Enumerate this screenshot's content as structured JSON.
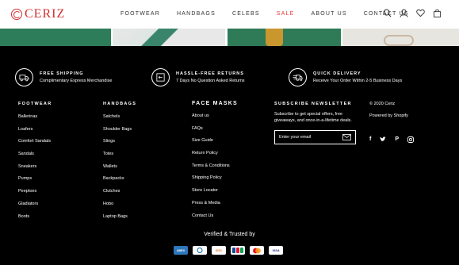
{
  "brand": {
    "name": "CERIZ",
    "color": "#d32f2f"
  },
  "nav": {
    "items": [
      "FOOTWEAR",
      "HANDBAGS",
      "CELEBS",
      "SALE",
      "ABOUT US",
      "CONTACT US"
    ],
    "sale_color": "#e53935"
  },
  "header_icons": [
    "search-icon",
    "account-icon",
    "wishlist-icon",
    "cart-icon"
  ],
  "promos": [
    {
      "title": "FREE SHIPPING",
      "subtitle": "Complimentary Express Merchandise",
      "icon": "truck-icon"
    },
    {
      "title": "HASSLE-FREE RETURNS",
      "subtitle": "7 Days No Question Asked Returns",
      "icon": "return-box-icon"
    },
    {
      "title": "QUICK DELIVERY",
      "subtitle": "Receive Your Order Within 2-5 Business Days",
      "icon": "delivery-icon"
    }
  ],
  "columns": {
    "footwear": {
      "heading": "FOOTWEAR",
      "links": [
        "Ballerinas",
        "Loafers",
        "Comfort Sandals",
        "Sandals",
        "Sneakers",
        "Pumps",
        "Peeptoes",
        "Gladiators",
        "Boots"
      ]
    },
    "handbags": {
      "heading": "HANDBAGS",
      "links": [
        "Satchels",
        "Shoulder Bags",
        "Slings",
        "Totes",
        "Wallets",
        "Backpacks",
        "Clutches",
        "Hobo",
        "Laptop Bags"
      ]
    },
    "facemasks": {
      "heading": "FACE MASKS",
      "links": [
        "About us",
        "FAQs",
        "Size Guide",
        "Return Policy",
        "Terms & Conditions",
        "Shipping Policy",
        "Store Locator",
        "Press & Media",
        "Contact Us"
      ]
    },
    "newsletter": {
      "heading": "SUBSCRIBE NEWSLETTER",
      "text": "Subscribe to get special offers, free giveaways, and once-in-a-lifetime deals.",
      "placeholder": "Enter your email"
    },
    "info": {
      "copyright": "© 2020 Ceriz",
      "powered": "Powered by Shopify",
      "social": [
        "facebook-icon",
        "twitter-icon",
        "pinterest-icon",
        "instagram-icon"
      ]
    }
  },
  "verified_text": "Verified & Trusted by",
  "payments": [
    "American Express",
    "Diners Club",
    "Discover",
    "JCB",
    "Mastercard",
    "Visa"
  ]
}
